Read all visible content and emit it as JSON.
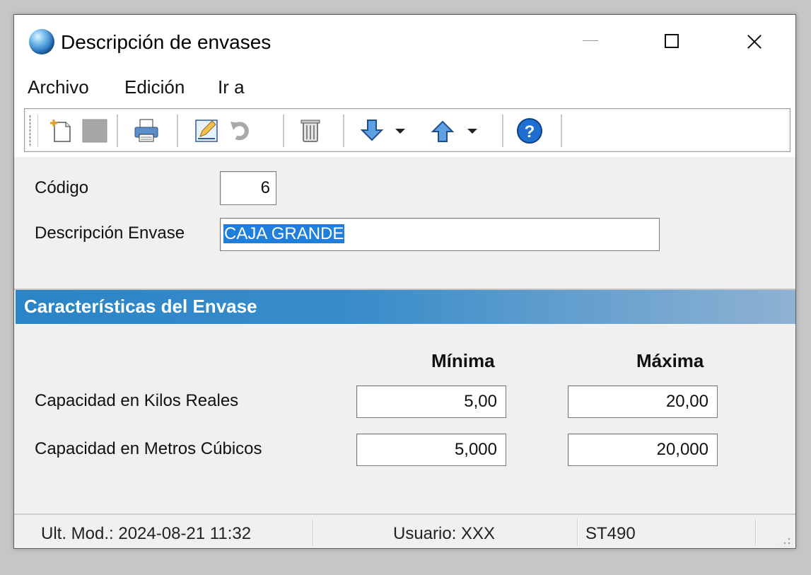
{
  "window": {
    "title": "Descripción de envases"
  },
  "menu": {
    "items": [
      "Archivo",
      "Edición",
      "Ir a"
    ]
  },
  "toolbar": {
    "buttons": [
      {
        "icon": "new-document-icon"
      },
      {
        "icon": "save-disabled-icon"
      },
      {
        "icon": "print-icon"
      },
      {
        "icon": "edit-icon"
      },
      {
        "icon": "undo-icon"
      },
      {
        "icon": "trash-icon"
      },
      {
        "icon": "arrow-down-icon"
      },
      {
        "icon": "arrow-up-icon"
      },
      {
        "icon": "help-icon"
      }
    ]
  },
  "form": {
    "codigo_label": "Código",
    "codigo_value": "6",
    "descripcion_label": "Descripción Envase",
    "descripcion_value": "CAJA GRANDE"
  },
  "section": {
    "title": "Características del Envase",
    "col_min": "Mínima",
    "col_max": "Máxima",
    "rows": [
      {
        "label": "Capacidad en Kilos Reales",
        "min": "5,00",
        "max": "20,00"
      },
      {
        "label": "Capacidad en Metros Cúbicos",
        "min": "5,000",
        "max": "20,000"
      }
    ]
  },
  "status": {
    "last_modified": "Ult. Mod.: 2024-08-21 11:32",
    "user": "Usuario: XXX",
    "code": "ST490"
  },
  "colors": {
    "section_header_start": "#2a84c6",
    "section_header_end": "#8fb2d3",
    "selection": "#1f7fdc"
  }
}
